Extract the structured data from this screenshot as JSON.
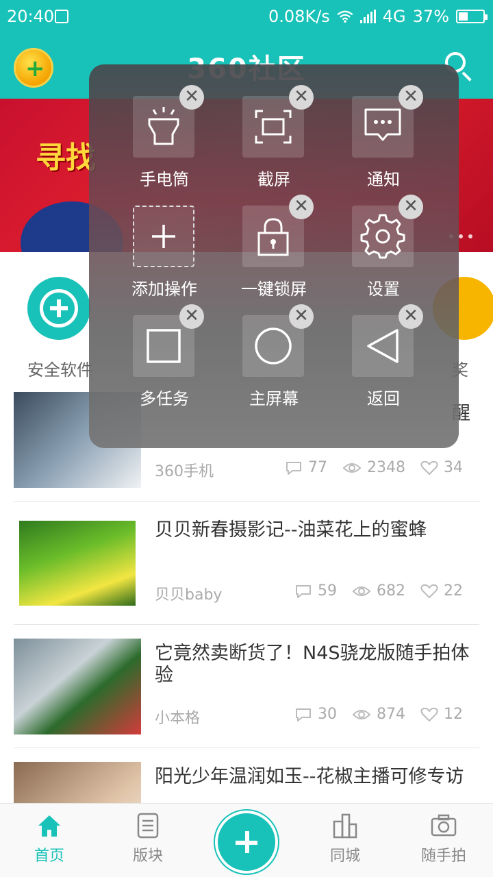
{
  "status_bar": {
    "time": "20:40",
    "speed": "0.08K/s",
    "network": "4G",
    "battery": "37%",
    "battery_level": 0.37
  },
  "header": {
    "title": "360社区"
  },
  "banner": {
    "text": "寻找"
  },
  "quick": {
    "left_label": "安全软件",
    "right_label": "奖"
  },
  "panel": {
    "tiles": [
      {
        "label": "手电筒",
        "icon": "flashlight-icon"
      },
      {
        "label": "截屏",
        "icon": "screenshot-icon"
      },
      {
        "label": "通知",
        "icon": "notification-icon"
      },
      {
        "label": "添加操作",
        "icon": "add-icon"
      },
      {
        "label": "一键锁屏",
        "icon": "lock-icon"
      },
      {
        "label": "设置",
        "icon": "gear-icon"
      },
      {
        "label": "多任务",
        "icon": "square-icon"
      },
      {
        "label": "主屏幕",
        "icon": "circle-icon"
      },
      {
        "label": "返回",
        "icon": "back-triangle-icon"
      }
    ],
    "close_glyph": "✕"
  },
  "feed": {
    "items": [
      {
        "title": "醒",
        "author": "360手机",
        "comments": "77",
        "views": "2348",
        "likes": "34"
      },
      {
        "title": "贝贝新春摄影记--油菜花上的蜜蜂",
        "author": "贝贝baby",
        "comments": "59",
        "views": "682",
        "likes": "22"
      },
      {
        "title": "它竟然卖断货了！N4S骁龙版随手拍体验",
        "author": "小本格",
        "comments": "30",
        "views": "874",
        "likes": "12"
      },
      {
        "title": "阳光少年温润如玉--花椒主播可修专访",
        "author": "",
        "comments": "",
        "views": "",
        "likes": ""
      }
    ]
  },
  "bottom_nav": {
    "tabs": [
      {
        "label": "首页",
        "icon": "home-icon"
      },
      {
        "label": "版块",
        "icon": "list-icon"
      },
      {
        "label": "同城",
        "icon": "city-icon"
      },
      {
        "label": "随手拍",
        "icon": "camera-icon"
      }
    ]
  },
  "colors": {
    "accent": "#19c2b8"
  }
}
